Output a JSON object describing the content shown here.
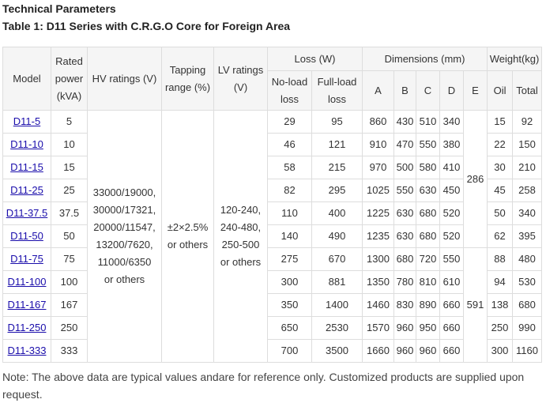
{
  "heading": "Technical Parameters",
  "caption": "Table 1: D11 Series with C.R.G.O Core for Foreign Area",
  "table": {
    "headers": {
      "model": "Model",
      "rated_power": [
        "Rated",
        "power",
        "(kVA)"
      ],
      "hv_ratings": "HV ratings (V)",
      "tapping_range": [
        "Tapping",
        "range (%)"
      ],
      "lv_ratings": [
        "LV ratings",
        "(V)"
      ],
      "loss": "Loss (W)",
      "no_load_loss": [
        "No-load",
        "loss"
      ],
      "full_load_loss": [
        "Full-load",
        "loss"
      ],
      "dimensions": "Dimensions (mm)",
      "dim_a": "A",
      "dim_b": "B",
      "dim_c": "C",
      "dim_d": "D",
      "dim_e": "E",
      "weight": "Weight(kg)",
      "oil": "Oil",
      "total": "Total"
    },
    "shared": {
      "hv_ratings": [
        "33000/19000,",
        "30000/17321,",
        "20000/11547,",
        "13200/7620,",
        "11000/6350",
        "or others"
      ],
      "tapping_range": [
        "±2×2.5%",
        "or others"
      ],
      "lv_ratings": [
        "120-240,",
        "240-480,",
        "250-500",
        "or others"
      ],
      "e_group1": "286",
      "e_group2": "591"
    },
    "rows": [
      {
        "model": "D11-5",
        "kva": "5",
        "no_load": "29",
        "full_load": "95",
        "a": "860",
        "b": "430",
        "c": "510",
        "d": "340",
        "oil": "15",
        "total": "92"
      },
      {
        "model": "D11-10",
        "kva": "10",
        "no_load": "46",
        "full_load": "121",
        "a": "910",
        "b": "470",
        "c": "550",
        "d": "380",
        "oil": "22",
        "total": "150"
      },
      {
        "model": "D11-15",
        "kva": "15",
        "no_load": "58",
        "full_load": "215",
        "a": "970",
        "b": "500",
        "c": "580",
        "d": "410",
        "oil": "30",
        "total": "210"
      },
      {
        "model": "D11-25",
        "kva": "25",
        "no_load": "82",
        "full_load": "295",
        "a": "1025",
        "b": "550",
        "c": "630",
        "d": "450",
        "oil": "45",
        "total": "258"
      },
      {
        "model": "D11-37.5",
        "kva": "37.5",
        "no_load": "110",
        "full_load": "400",
        "a": "1225",
        "b": "630",
        "c": "680",
        "d": "520",
        "oil": "50",
        "total": "340"
      },
      {
        "model": "D11-50",
        "kva": "50",
        "no_load": "140",
        "full_load": "490",
        "a": "1235",
        "b": "630",
        "c": "680",
        "d": "520",
        "oil": "62",
        "total": "395"
      },
      {
        "model": "D11-75",
        "kva": "75",
        "no_load": "275",
        "full_load": "670",
        "a": "1300",
        "b": "680",
        "c": "720",
        "d": "550",
        "oil": "88",
        "total": "480"
      },
      {
        "model": "D11-100",
        "kva": "100",
        "no_load": "300",
        "full_load": "881",
        "a": "1350",
        "b": "780",
        "c": "810",
        "d": "610",
        "oil": "94",
        "total": "530"
      },
      {
        "model": "D11-167",
        "kva": "167",
        "no_load": "350",
        "full_load": "1400",
        "a": "1460",
        "b": "830",
        "c": "890",
        "d": "660",
        "oil": "138",
        "total": "680"
      },
      {
        "model": "D11-250",
        "kva": "250",
        "no_load": "650",
        "full_load": "2530",
        "a": "1570",
        "b": "960",
        "c": "950",
        "d": "660",
        "oil": "250",
        "total": "990"
      },
      {
        "model": "D11-333",
        "kva": "333",
        "no_load": "700",
        "full_load": "3500",
        "a": "1660",
        "b": "960",
        "c": "960",
        "d": "660",
        "oil": "300",
        "total": "1160"
      }
    ]
  },
  "note": "Note: The above data are typical values andare for reference only. Customized products are supplied upon request."
}
